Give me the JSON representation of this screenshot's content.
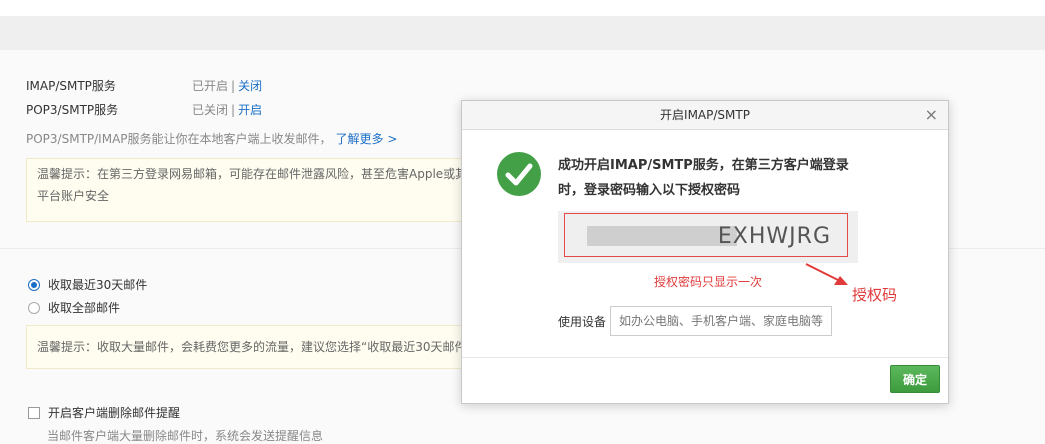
{
  "services": {
    "imap": {
      "label": "IMAP/SMTP服务",
      "status": "已开启",
      "action": "关闭"
    },
    "pop3": {
      "label": "POP3/SMTP服务",
      "status": "已关闭",
      "action": "开启"
    },
    "separator": "|"
  },
  "description": {
    "text": "POP3/SMTP/IMAP服务能让你在本地客户端上收发邮件，",
    "link": "了解更多 >"
  },
  "tip1": {
    "line1": "温馨提示：在第三方登录网易邮箱，可能存在邮件泄露风险，甚至危害Apple或其",
    "line2": "平台账户安全"
  },
  "receive_options": [
    {
      "label": "收取最近30天邮件",
      "selected": true
    },
    {
      "label": "收取全部邮件",
      "selected": false
    }
  ],
  "tip2": {
    "text": "温馨提示：收取大量邮件，会耗费您更多的流量，建议您选择“收取最近30天邮件"
  },
  "delete_alert": {
    "label": "开启客户端删除邮件提醒",
    "checked": false,
    "hint": "当邮件客户端大量删除邮件时，系统会发送提醒信息"
  },
  "modal": {
    "title": "开启IMAP/SMTP",
    "close": "×",
    "message": "成功开启IMAP/SMTP服务，在第三方客户端登录时，登录密码输入以下授权密码",
    "code_visible": "EXHWJRG",
    "note": "授权密码只显示一次",
    "device_label": "使用设备",
    "device_placeholder": "如办公电脑、手机客户端、家庭电脑等",
    "confirm": "确定"
  },
  "annotation": {
    "text": "授权码",
    "color": "#e03a3a"
  },
  "colors": {
    "link": "#1d6fc6",
    "success": "#43a047",
    "confirm": "#4caf50",
    "warning_text": "#e03a3a"
  }
}
